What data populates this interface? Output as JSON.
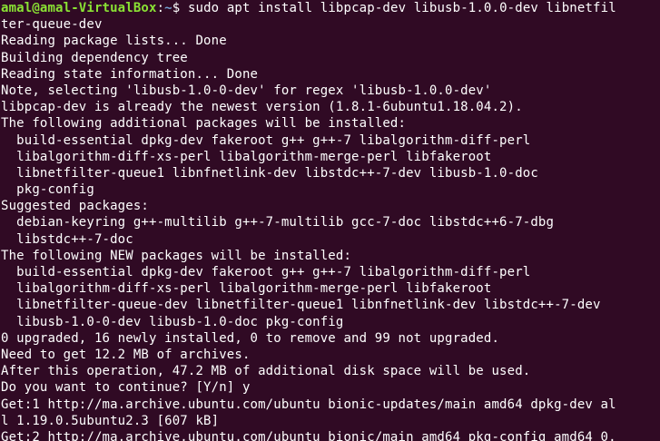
{
  "prompt": {
    "user_host": "amal@amal-VirtualBox",
    "separator": ":",
    "path": "~",
    "symbol": "$ ",
    "command_first": "sudo apt install libpcap-dev libusb-1.0.0-dev libnetfil"
  },
  "colors": {
    "background": "#300a24",
    "text": "#ffffff",
    "user_host": "#8ae234",
    "path": "#729fcf"
  },
  "output_lines": [
    "ter-queue-dev",
    "Reading package lists... Done",
    "Building dependency tree",
    "Reading state information... Done",
    "Note, selecting 'libusb-1.0-0-dev' for regex 'libusb-1.0.0-dev'",
    "libpcap-dev is already the newest version (1.8.1-6ubuntu1.18.04.2).",
    "The following additional packages will be installed:",
    "  build-essential dpkg-dev fakeroot g++ g++-7 libalgorithm-diff-perl",
    "  libalgorithm-diff-xs-perl libalgorithm-merge-perl libfakeroot",
    "  libnetfilter-queue1 libnfnetlink-dev libstdc++-7-dev libusb-1.0-doc",
    "  pkg-config",
    "Suggested packages:",
    "  debian-keyring g++-multilib g++-7-multilib gcc-7-doc libstdc++6-7-dbg",
    "  libstdc++-7-doc",
    "The following NEW packages will be installed:",
    "  build-essential dpkg-dev fakeroot g++ g++-7 libalgorithm-diff-perl",
    "  libalgorithm-diff-xs-perl libalgorithm-merge-perl libfakeroot",
    "  libnetfilter-queue-dev libnetfilter-queue1 libnfnetlink-dev libstdc++-7-dev",
    "  libusb-1.0-0-dev libusb-1.0-doc pkg-config",
    "0 upgraded, 16 newly installed, 0 to remove and 99 not upgraded.",
    "Need to get 12.2 MB of archives.",
    "After this operation, 47.2 MB of additional disk space will be used.",
    "Do you want to continue? [Y/n] y",
    "Get:1 http://ma.archive.ubuntu.com/ubuntu bionic-updates/main amd64 dpkg-dev al",
    "l 1.19.0.5ubuntu2.3 [607 kB]",
    "Get:2 http://ma.archive.ubuntu.com/ubuntu bionic/main amd64 pkg-config amd64 0."
  ]
}
